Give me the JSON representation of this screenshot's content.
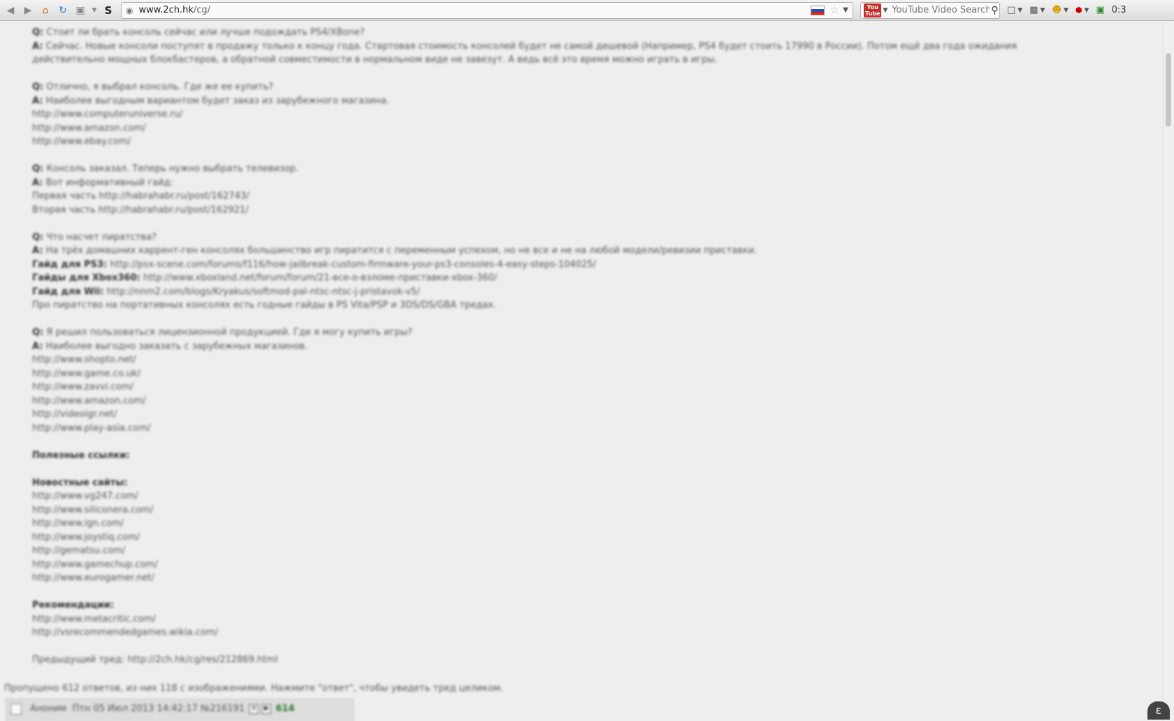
{
  "browser": {
    "url_host": "www.2ch.hk",
    "url_path": "/cg/",
    "search_placeholder": "YouTube Video Search",
    "clock": "0:3"
  },
  "post": {
    "blocks": [
      {
        "lines": [
          {
            "parts": [
              {
                "t": "Q:",
                "s": "q"
              },
              {
                "t": " Стоит ли брать консоль сейчас или лучше подождать PS4/XBone?"
              }
            ]
          },
          {
            "parts": [
              {
                "t": "A:",
                "s": "a"
              },
              {
                "t": " Сейчас. Новые консоли поступят в продажу только к концу года. Стартовая стоимость консолей будет не самой дешевой (Например, PS4 будет стоить 17990 в России). Потом ещё два года ожидания"
              }
            ]
          },
          {
            "parts": [
              {
                "t": "действительно мощных блокбастеров, а обратной совместимости в нормальном виде не завезут. А ведь всё это время можно играть в игры."
              }
            ]
          }
        ]
      },
      {
        "lines": [
          {
            "parts": [
              {
                "t": "Q:",
                "s": "q"
              },
              {
                "t": " Отлично, я выбрал консоль. Где же ее купить?"
              }
            ]
          },
          {
            "parts": [
              {
                "t": "A:",
                "s": "a"
              },
              {
                "t": " Наиболее выгодным вариантом будет заказ из зарубежного магазина."
              }
            ]
          },
          {
            "parts": [
              {
                "t": "http://www.computeruniverse.ru/",
                "s": "link"
              }
            ]
          },
          {
            "parts": [
              {
                "t": "http://www.amazon.com/",
                "s": "link"
              }
            ]
          },
          {
            "parts": [
              {
                "t": "http://www.ebay.com/",
                "s": "link"
              }
            ]
          }
        ]
      },
      {
        "lines": [
          {
            "parts": [
              {
                "t": "Q:",
                "s": "q"
              },
              {
                "t": " Консоль заказал. Теперь нужно выбрать телевизор."
              }
            ]
          },
          {
            "parts": [
              {
                "t": "A:",
                "s": "a"
              },
              {
                "t": " Вот информативный гайд:"
              }
            ]
          },
          {
            "parts": [
              {
                "t": "Первая часть "
              },
              {
                "t": "http://habrahabr.ru/post/162743/",
                "s": "link"
              }
            ]
          },
          {
            "parts": [
              {
                "t": "Вторая часть "
              },
              {
                "t": "http://habrahabr.ru/post/162921/",
                "s": "link"
              }
            ]
          }
        ]
      },
      {
        "lines": [
          {
            "parts": [
              {
                "t": "Q:",
                "s": "q"
              },
              {
                "t": " Что насчет пиратства?"
              }
            ]
          },
          {
            "parts": [
              {
                "t": "A:",
                "s": "a"
              },
              {
                "t": " На трёх домашних каррент-ген консолях большинство игр пиратится с переменным успехом, но не все и не на любой модели/ревизии приставки."
              }
            ]
          },
          {
            "parts": [
              {
                "t": "Гайд для PS3:",
                "s": "bold"
              },
              {
                "t": " "
              },
              {
                "t": "http://psx-scene.com/forums/f116/how-jailbreak-custom-firmware-your-ps3-consoles-4-easy-steps-104025/",
                "s": "link"
              }
            ]
          },
          {
            "parts": [
              {
                "t": "Гайды для Xbox360:",
                "s": "bold"
              },
              {
                "t": " "
              },
              {
                "t": "http://www.xboxland.net/forum/forum/21-все-о-взломе-приставки-xbox-360/",
                "s": "link"
              }
            ]
          },
          {
            "parts": [
              {
                "t": "Гайд для Wii:",
                "s": "bold"
              },
              {
                "t": " "
              },
              {
                "t": "http://nnm2.com/blogs/Kryakus/softmod-pal-ntsc-ntsc-j-pristavok-v5/",
                "s": "link"
              }
            ]
          },
          {
            "parts": [
              {
                "t": "Про пиратство на портативных консолях есть годные гайды в PS Vita/PSP и 3DS/DS/GBA тредах."
              }
            ]
          }
        ]
      },
      {
        "lines": [
          {
            "parts": [
              {
                "t": "Q:",
                "s": "q"
              },
              {
                "t": " Я решил пользоваться лицензионной продукцией. Где я могу купить игры?"
              }
            ]
          },
          {
            "parts": [
              {
                "t": "A:",
                "s": "a"
              },
              {
                "t": " Наиболее выгодно заказать с зарубежных магазинов."
              }
            ]
          },
          {
            "parts": [
              {
                "t": "http://www.shopto.net/",
                "s": "link"
              }
            ]
          },
          {
            "parts": [
              {
                "t": "http://www.game.co.uk/",
                "s": "link"
              }
            ]
          },
          {
            "parts": [
              {
                "t": "http://www.zavvi.com/",
                "s": "link"
              }
            ]
          },
          {
            "parts": [
              {
                "t": "http://www.amazon.com/",
                "s": "link"
              }
            ]
          },
          {
            "parts": [
              {
                "t": "http://videoigr.net/",
                "s": "link"
              }
            ]
          },
          {
            "parts": [
              {
                "t": "http://www.play-asia.com/",
                "s": "link"
              }
            ]
          }
        ]
      },
      {
        "lines": [
          {
            "parts": [
              {
                "t": "Полезные ссылки:",
                "s": "bold"
              }
            ]
          }
        ]
      },
      {
        "lines": [
          {
            "parts": [
              {
                "t": "Новостные сайты:",
                "s": "bold"
              }
            ]
          },
          {
            "parts": [
              {
                "t": "http://www.vg247.com/",
                "s": "link"
              }
            ]
          },
          {
            "parts": [
              {
                "t": "http://www.siliconera.com/",
                "s": "link"
              }
            ]
          },
          {
            "parts": [
              {
                "t": "http://www.ign.com/",
                "s": "link"
              }
            ]
          },
          {
            "parts": [
              {
                "t": "http://www.joystiq.com/",
                "s": "link"
              }
            ]
          },
          {
            "parts": [
              {
                "t": "http://gematsu.com/",
                "s": "link"
              }
            ]
          },
          {
            "parts": [
              {
                "t": "http://www.gamechup.com/",
                "s": "link"
              }
            ]
          },
          {
            "parts": [
              {
                "t": "http://www.eurogamer.net/",
                "s": "link"
              }
            ]
          }
        ]
      },
      {
        "lines": [
          {
            "parts": [
              {
                "t": "Рекомендации:",
                "s": "bold"
              }
            ]
          },
          {
            "parts": [
              {
                "t": "http://www.metacritic.com/",
                "s": "link"
              }
            ]
          },
          {
            "parts": [
              {
                "t": "http://vsrecommendedgames.wikia.com/",
                "s": "link"
              }
            ]
          }
        ]
      },
      {
        "lines": [
          {
            "parts": [
              {
                "t": "Предыдущий тред: "
              },
              {
                "t": "http://2ch.hk/cg/res/212869.html",
                "s": "link"
              }
            ]
          }
        ]
      }
    ]
  },
  "omitted_text": "Пропущено 612 ответов, из них 118 с изображениями. Нажмите \"ответ\", чтобы увидеть тред целиком.",
  "reply": {
    "name": "Аноним",
    "date": "Птн 05 Июл 2013 14:42:17",
    "post_no": "№216191",
    "count": "614"
  }
}
